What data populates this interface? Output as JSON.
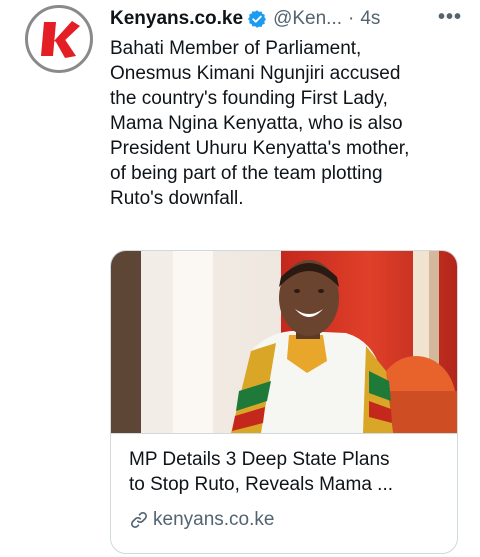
{
  "tweet": {
    "account_name": "Kenyans.co.ke",
    "handle": "@Ken...",
    "separator": "·",
    "time": "4s",
    "more_icon": "•••",
    "text": "Bahati Member of Parliament,\nOnesmus Kimani Ngunjiri accused\nthe country's founding First Lady,\nMama Ngina Kenyatta, who is also\nPresident Uhuru Kenyatta's mother,\nof being part of the team plotting\nRuto's downfall."
  },
  "card": {
    "title_line1": "MP Details 3 Deep State Plans",
    "title_line2": "to Stop Ruto, Reveals Mama ...",
    "domain": "kenyans.co.ke"
  },
  "icons": {
    "avatar": "kenyans-logo-icon",
    "verified": "verified-badge-icon",
    "link": "link-icon"
  },
  "colors": {
    "brand_red": "#e31e24",
    "verified_blue": "#1d9bf0",
    "muted_text": "#536471",
    "border": "#cfd9de"
  }
}
